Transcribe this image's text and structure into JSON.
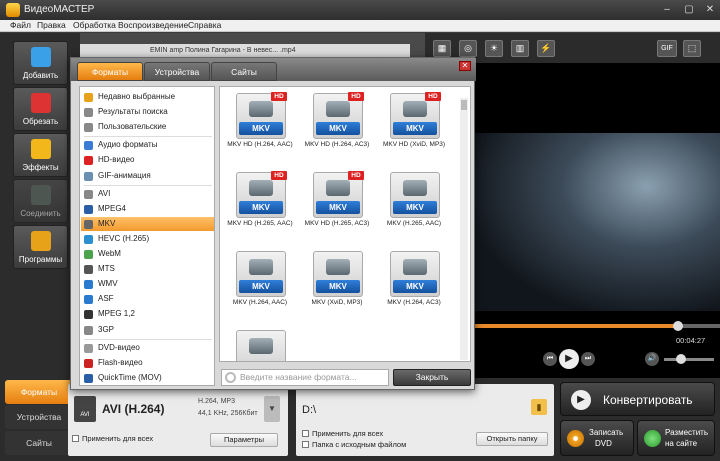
{
  "app": {
    "title": "ВидеоМАСТЕР"
  },
  "menu": [
    "Файл",
    "Правка",
    "Обработка",
    "Воспроизведение",
    "Справка"
  ],
  "sidebar": {
    "items": [
      {
        "label": "Добавить",
        "icon": "add-film-icon",
        "color": "#3aa0e8"
      },
      {
        "label": "Обрезать",
        "icon": "scissors-icon",
        "color": "#d33"
      },
      {
        "label": "Эффекты",
        "icon": "effects-icon",
        "color": "#f2b81b"
      },
      {
        "label": "Соединить",
        "icon": "join-icon",
        "color": "#6a7a70"
      },
      {
        "label": "Программы",
        "icon": "programs-icon",
        "color": "#e8a21a"
      }
    ],
    "bottom_tabs": [
      "Форматы",
      "Устройства",
      "Сайты"
    ]
  },
  "file_strip": "EMIN amp Полина Гагарина - В невес... .mp4",
  "dialog": {
    "tabs": [
      "Форматы",
      "Устройства",
      "Сайты"
    ],
    "categories": [
      {
        "label": "Недавно выбранные",
        "icon": "recent-icon",
        "color": "#e8a21a"
      },
      {
        "label": "Результаты поиска",
        "icon": "search-results-icon",
        "color": "#888"
      },
      {
        "label": "Пользовательские",
        "icon": "user-icon",
        "color": "#888"
      },
      {
        "label": "Аудио форматы",
        "icon": "audio-icon",
        "color": "#3a7bd5"
      },
      {
        "label": "HD-видео",
        "icon": "hd-icon",
        "color": "#d22"
      },
      {
        "label": "GIF-анимация",
        "icon": "gif-icon",
        "color": "#6a8fb0"
      },
      {
        "label": "AVI",
        "icon": "avi-icon",
        "color": "#888"
      },
      {
        "label": "MPEG4",
        "icon": "mpeg4-icon",
        "color": "#2a5fa8"
      },
      {
        "label": "MKV",
        "icon": "mkv-icon",
        "color": "#666"
      },
      {
        "label": "HEVC (H.265)",
        "icon": "hevc-icon",
        "color": "#2a8fd0"
      },
      {
        "label": "WebM",
        "icon": "webm-icon",
        "color": "#4ba34b"
      },
      {
        "label": "MTS",
        "icon": "mts-icon",
        "color": "#555"
      },
      {
        "label": "WMV",
        "icon": "wmv-icon",
        "color": "#2a7ad0"
      },
      {
        "label": "ASF",
        "icon": "asf-icon",
        "color": "#2a7ad0"
      },
      {
        "label": "MPEG 1,2",
        "icon": "mpeg-icon",
        "color": "#333"
      },
      {
        "label": "3GP",
        "icon": "3gp-icon",
        "color": "#888"
      },
      {
        "label": "DVD-видео",
        "icon": "dvd-icon",
        "color": "#999"
      },
      {
        "label": "Flash-видео",
        "icon": "flash-icon",
        "color": "#c22"
      },
      {
        "label": "QuickTime (MOV)",
        "icon": "quicktime-icon",
        "color": "#2a5fa8"
      }
    ],
    "selected_category": "MKV",
    "formats": [
      {
        "label": "MKV HD (H.264, AAC)",
        "hd": "HD",
        "tag": "MKV"
      },
      {
        "label": "MKV HD (H.264, AC3)",
        "hd": "HD",
        "tag": "MKV"
      },
      {
        "label": "MKV HD (XviD, MP3)",
        "hd": "HD",
        "tag": "MKV"
      },
      {
        "label": "MKV HD (H.265, AAC)",
        "hd": "HD",
        "tag": "MKV"
      },
      {
        "label": "MKV HD (H.265, AC3)",
        "hd": "HD",
        "tag": "MKV"
      },
      {
        "label": "MKV (H.265, AAC)",
        "hd": "",
        "tag": "MKV"
      },
      {
        "label": "MKV (H.264, AAC)",
        "hd": "",
        "tag": "MKV"
      },
      {
        "label": "MKV (XviD, MP3)",
        "hd": "",
        "tag": "MKV"
      },
      {
        "label": "MKV (H.264, AC3)",
        "hd": "",
        "tag": "MKV"
      },
      {
        "label": "",
        "hd": "",
        "tag": ""
      }
    ],
    "search_placeholder": "Введите название формата...",
    "close_label": "Закрыть"
  },
  "player": {
    "time": "00:04:27",
    "progress": 0.81
  },
  "format_panel": {
    "name": "AVI (H.264)",
    "badge": "AVI",
    "codec": "H.264, MP3",
    "audio": "44,1 KHz, 256Кбит",
    "apply_all": "Применить для всех",
    "params": "Параметры"
  },
  "output_panel": {
    "path": "D:\\",
    "apply_all": "Применить для всех",
    "source_folder": "Папка с исходным файлом",
    "open_folder": "Открыть папку"
  },
  "actions": {
    "convert": "Конвертировать",
    "dvd_line1": "Записать",
    "dvd_line2": "DVD",
    "web_line1": "Разместить",
    "web_line2": "на сайте"
  },
  "toolbar_gif": "GIF"
}
